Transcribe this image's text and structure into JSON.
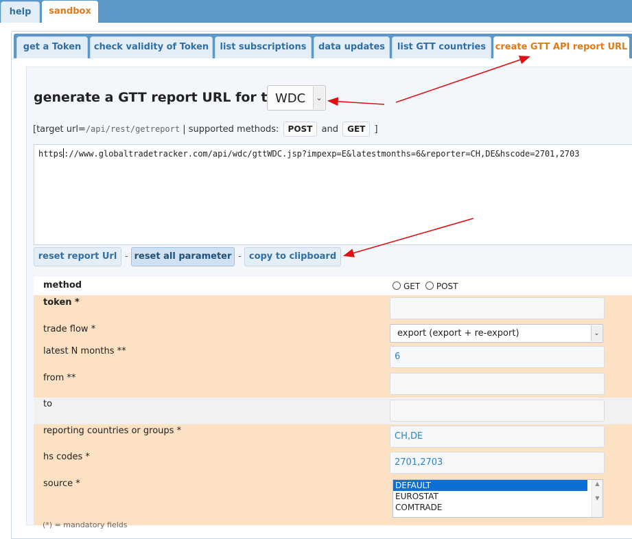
{
  "top_tabs": [
    {
      "label": "help"
    },
    {
      "label": "sandbox",
      "active": true
    }
  ],
  "sub_tabs": [
    {
      "label": "get a Token"
    },
    {
      "label": "check validity of Token"
    },
    {
      "label": "list subscriptions"
    },
    {
      "label": "data updates"
    },
    {
      "label": "list GTT countries"
    },
    {
      "label": "create GTT API report URL",
      "active": true
    }
  ],
  "header": {
    "title": "generate a GTT report URL for the",
    "database_selected": "WDC"
  },
  "target": {
    "prefix": "[target url=",
    "url": "/api/rest/getreport",
    "supported_text": " | supported methods:",
    "method_post": "POST",
    "and_text": "and",
    "method_get": "GET",
    "suffix": "]"
  },
  "report_url": {
    "before_caret": "https",
    "after_caret": "://www.globaltradetracker.com/api/wdc/gttWDC.jsp?impexp=E&latestmonths=6&reporter=CH,DE&hscode=2701,2703"
  },
  "buttons": {
    "reset_url": "reset report Url",
    "reset_all": "reset all parameter",
    "copy": "copy to clipboard",
    "separator": "-"
  },
  "form": {
    "method": {
      "label": "method",
      "option_get": "GET",
      "option_post": "POST"
    },
    "token": {
      "label": "token *",
      "value": ""
    },
    "trade_flow": {
      "label": "trade flow *",
      "value": "export (export + re-export)"
    },
    "latest_months": {
      "label": "latest N months **",
      "value": "6"
    },
    "from": {
      "label": "from **",
      "value": ""
    },
    "to": {
      "label": "to",
      "value": ""
    },
    "reporters": {
      "label": "reporting countries or groups *",
      "value": "CH,DE"
    },
    "hs_codes": {
      "label": "hs codes *",
      "value": "2701,2703"
    },
    "source": {
      "label": "source *",
      "options": [
        "DEFAULT",
        "EUROSTAT",
        "COMTRADE"
      ],
      "selected": "DEFAULT"
    }
  },
  "footer_note": "(*) = mandatory fields",
  "colors": {
    "accent_blue": "#5b97c9",
    "active_tab_text": "#e07a18",
    "row_highlight": "#fde1c4",
    "arrow_red": "#e01010"
  }
}
